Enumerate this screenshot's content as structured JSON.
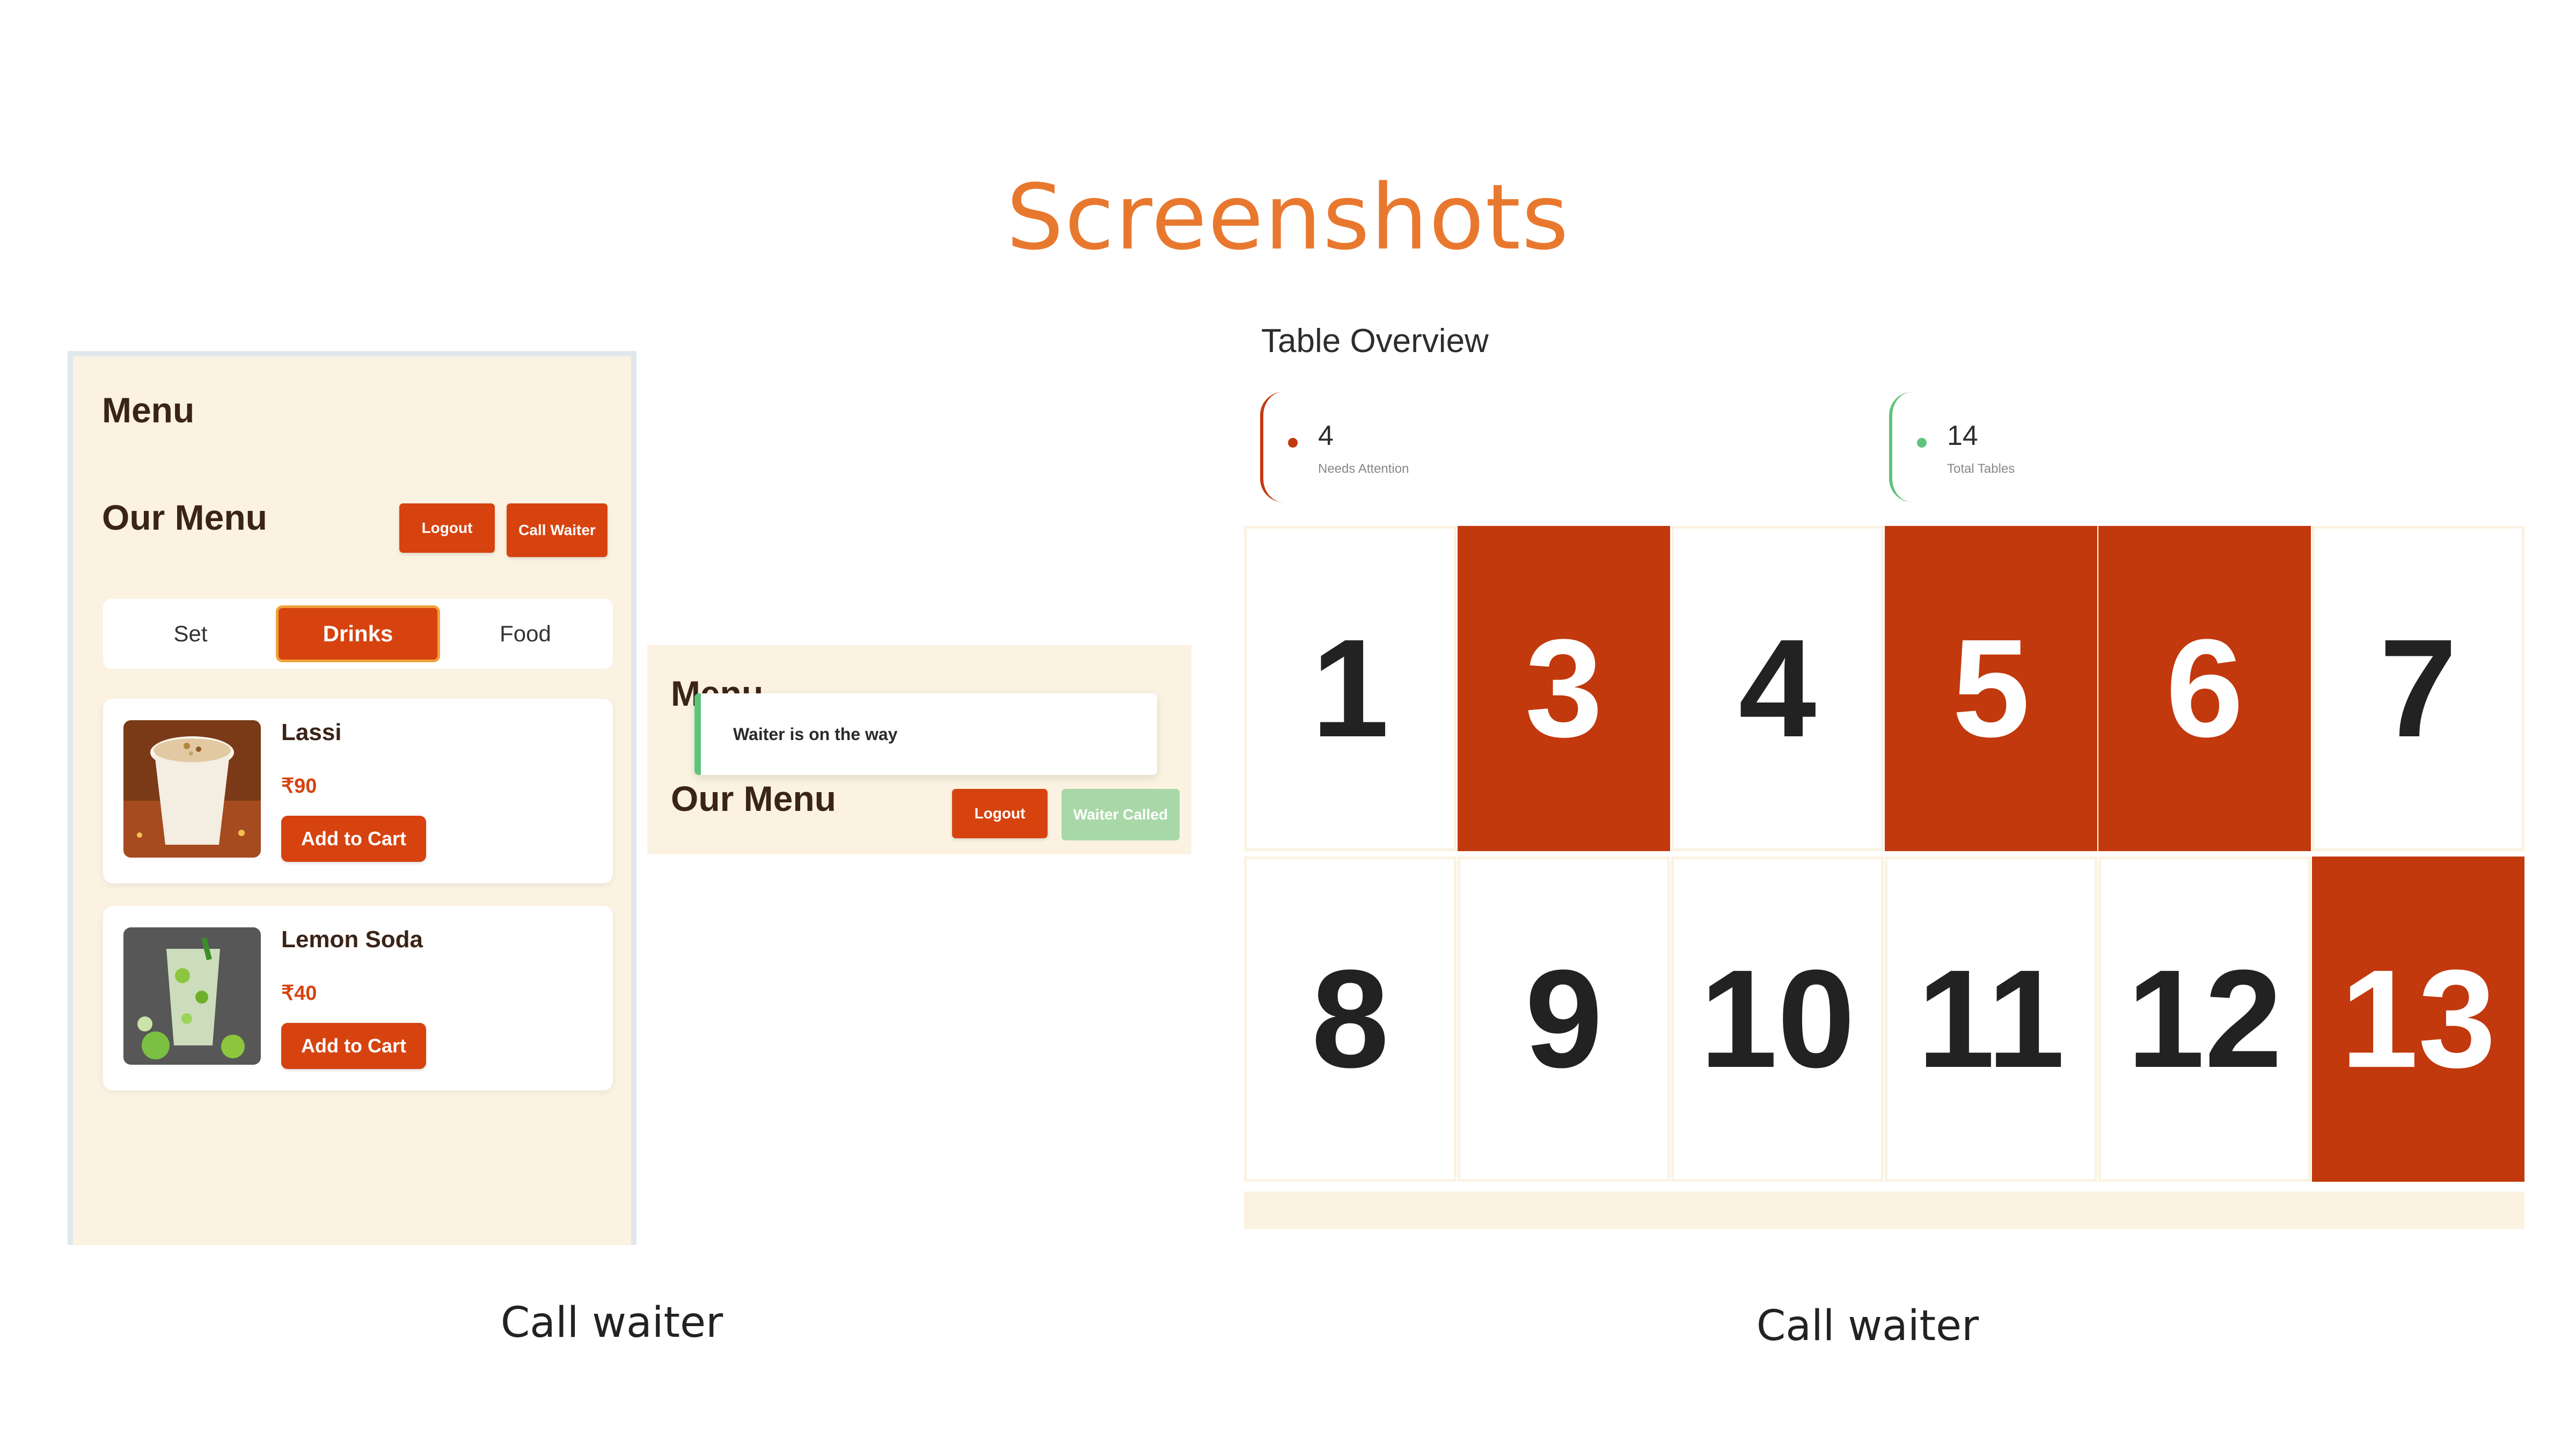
{
  "slide": {
    "title": "Screenshots",
    "captions": [
      "Call waiter",
      "Call waiter"
    ]
  },
  "menu_screen": {
    "app_title": "Menu",
    "section_title": "Our Menu",
    "logout_label": "Logout",
    "call_waiter_label": "Call Waiter",
    "tabs": [
      {
        "label": "Set",
        "active": false
      },
      {
        "label": "Drinks",
        "active": true
      },
      {
        "label": "Food",
        "active": false
      }
    ],
    "items": [
      {
        "name": "Lassi",
        "price": "₹90",
        "add_label": "Add to Cart",
        "image_icon": "lassi-glass-icon"
      },
      {
        "name": "Lemon Soda",
        "price": "₹40",
        "add_label": "Add to Cart",
        "image_icon": "lemon-soda-glass-icon"
      }
    ]
  },
  "toast_screen": {
    "app_title": "Menu",
    "toast_message": "Waiter is on the way",
    "section_title": "Our Menu",
    "logout_label": "Logout",
    "waiter_called_label": "Waiter Called"
  },
  "table_overview": {
    "title": "Table Overview",
    "stats": [
      {
        "value": "4",
        "label": "Needs Attention",
        "color": "#c2390e"
      },
      {
        "value": "14",
        "label": "Total Tables",
        "color": "#5ec47a"
      }
    ],
    "rows": [
      [
        {
          "number": "1",
          "attention": false
        },
        {
          "number": "3",
          "attention": true
        },
        {
          "number": "4",
          "attention": false
        },
        {
          "number": "5",
          "attention": true
        },
        {
          "number": "6",
          "attention": true
        },
        {
          "number": "7",
          "attention": false
        }
      ],
      [
        {
          "number": "8",
          "attention": false
        },
        {
          "number": "9",
          "attention": false
        },
        {
          "number": "10",
          "attention": false
        },
        {
          "number": "11",
          "attention": false
        },
        {
          "number": "12",
          "attention": false
        },
        {
          "number": "13",
          "attention": true
        }
      ]
    ]
  },
  "colors": {
    "accent": "#d6430f",
    "attention": "#c2390e",
    "success": "#5ec47a",
    "cream": "#fbf2e1",
    "title_orange": "#e9782f"
  }
}
